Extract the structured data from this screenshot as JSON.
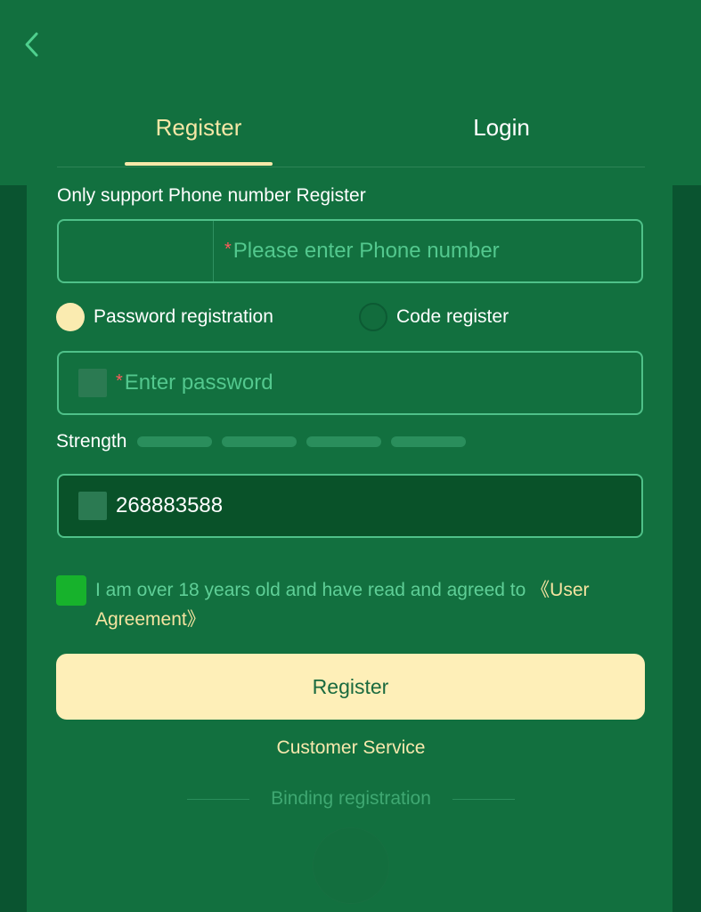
{
  "tabs": {
    "register": "Register",
    "login": "Login"
  },
  "hint": "Only support Phone number Register",
  "phone": {
    "required_mark": "*",
    "placeholder": "Please enter Phone number"
  },
  "mode": {
    "password_label": "Password registration",
    "code_label": "Code register",
    "selected": "password"
  },
  "password": {
    "required_mark": "*",
    "placeholder": "Enter password"
  },
  "strength": {
    "label": "Strength",
    "segments": 4,
    "level": 0
  },
  "invite": {
    "value": "268883588"
  },
  "agreement": {
    "text": "I am over 18 years old and have read and agreed to ",
    "link": "《User Agreement》",
    "checked": true
  },
  "register_button": "Register",
  "customer_service": "Customer Service",
  "binding_registration": "Binding registration",
  "colors": {
    "accent": "#feefb8",
    "background": "#12703f",
    "checkbox": "#17b22c"
  },
  "icons": {
    "back": "chevron-left-icon"
  }
}
